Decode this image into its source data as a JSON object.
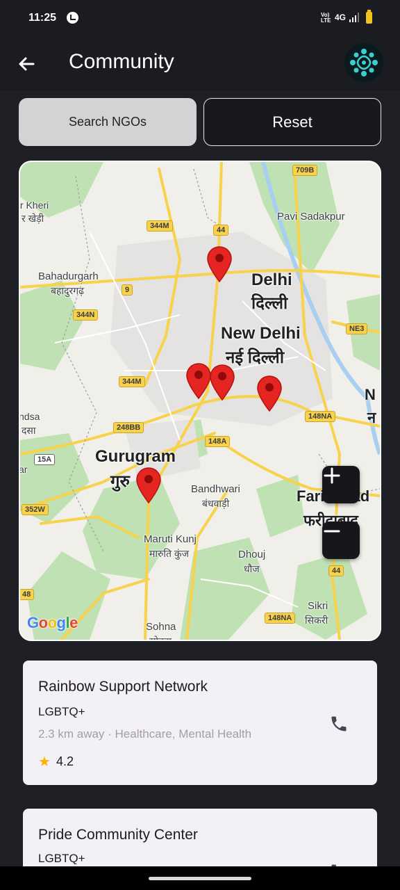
{
  "status_bar": {
    "time": "11:25",
    "volte": "VoLTE",
    "network": "4G",
    "battery_color": "#f2c21a"
  },
  "app_bar": {
    "back_icon": "arrow-left-icon",
    "title": "Community",
    "logo_icon": "community-logo-icon"
  },
  "actions": {
    "search_label": "Search NGOs",
    "reset_label": "Reset"
  },
  "map": {
    "labels": {
      "kheri_en": "ır Kheri",
      "kheri_hi": "र खेड़ी",
      "pavi": "Pavi Sadakpur",
      "bahadurgarh_en": "Bahadurgarh",
      "bahadurgarh_hi": "बहादुरगढ़",
      "delhi_en": "Delhi",
      "delhi_hi": "दिल्ली",
      "newdelhi_en": "New Delhi",
      "newdelhi_hi": "नई दिल्ली",
      "n_en": "N",
      "n_hi": "न",
      "ndsa_en": "ndsa",
      "ndsa_hi": "दसा",
      "gurugram_en": "Gurugram",
      "gurugram_hi": "गुरु",
      "ar": "ar",
      "bandhwari_en": "Bandhwari",
      "bandhwari_hi": "बंधवाड़ी",
      "faridabad_en": "Faridabad",
      "faridabad_hi": "फरीदाबाद",
      "marutikunj_en": "Maruti Kunj",
      "marutikunj_hi": "मारुति कुंज",
      "dhouj_en": "Dhouj",
      "dhouj_hi": "धौज",
      "sikri_en": "Sikri",
      "sikri_hi": "सिकरी",
      "sohna_en": "Sohna",
      "sohna_hi": "सोहना"
    },
    "road_shields": {
      "r709b": "709B",
      "r344m_top": "344M",
      "r44_top": "44",
      "r9": "9",
      "r344n": "344N",
      "rne3": "NE3",
      "r344m_mid": "344M",
      "r248bb": "248BB",
      "r148na_right": "148NA",
      "r148a": "148A",
      "r15a": "15A",
      "r352w": "352W",
      "r44_bottom": "44",
      "r48": "48",
      "r148na_bottom": "148NA"
    },
    "zoom_in_icon": "plus-icon",
    "zoom_out_icon": "minus-icon",
    "attribution": "Google",
    "pin_color": "#e52521"
  },
  "ngos": [
    {
      "name": "Rainbow Support Network",
      "category": "LGBTQ+",
      "meta": "2.3 km away · Healthcare, Mental Health",
      "rating": "4.2",
      "phone_icon": "phone-icon"
    },
    {
      "name": "Pride Community Center",
      "category": "LGBTQ+",
      "phone_icon": "phone-icon"
    }
  ]
}
